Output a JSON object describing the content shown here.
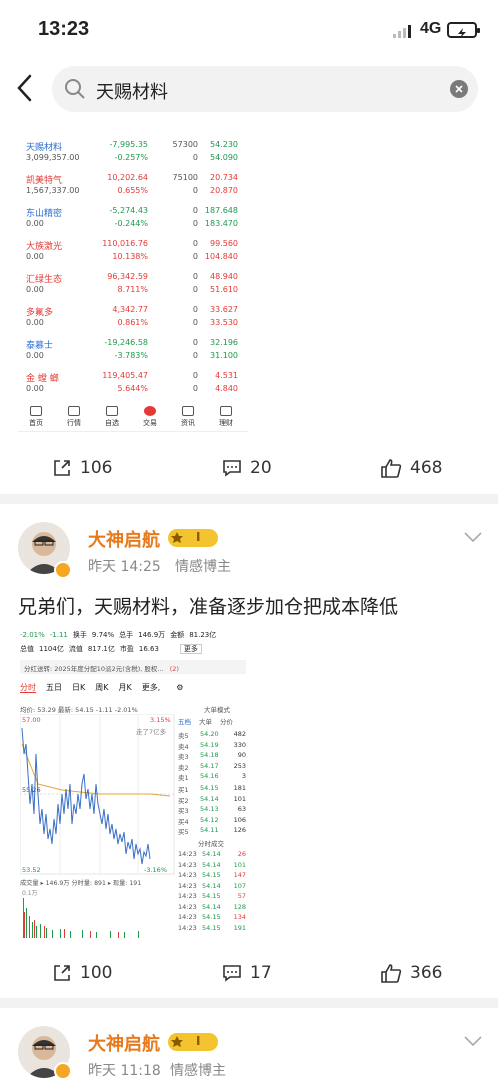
{
  "status_bar": {
    "time": "13:23",
    "network": "4G"
  },
  "search": {
    "query": "天赐材料"
  },
  "post1": {
    "screenshot": {
      "stocks": [
        {
          "name": "天赐材料",
          "sub": "3,099,357.00",
          "v1": "-7,995.35",
          "v1b": "-0.257%",
          "v2": "57300",
          "v2b": "0",
          "v3": "54.230",
          "v3b": "54.090",
          "color": "blue"
        },
        {
          "name": "凯美特气",
          "sub": "1,567,337.00",
          "v1": "10,202.64",
          "v1b": "0.655%",
          "v2": "75100",
          "v2b": "0",
          "v3": "20.734",
          "v3b": "20.870",
          "color": "red"
        },
        {
          "name": "东山精密",
          "sub": "0.00",
          "v1": "-5,274.43",
          "v1b": "-0.244%",
          "v2": "0",
          "v2b": "0",
          "v3": "187.648",
          "v3b": "183.470",
          "color": "blue"
        },
        {
          "name": "大族激光",
          "sub": "0.00",
          "v1": "110,016.76",
          "v1b": "10.138%",
          "v2": "0",
          "v2b": "0",
          "v3": "99.560",
          "v3b": "104.840",
          "color": "red"
        },
        {
          "name": "汇绿生态",
          "sub": "0.00",
          "v1": "96,342.59",
          "v1b": "8.711%",
          "v2": "0",
          "v2b": "0",
          "v3": "48.940",
          "v3b": "51.610",
          "color": "red"
        },
        {
          "name": "多氟多",
          "sub": "0.00",
          "v1": "4,342.77",
          "v1b": "0.861%",
          "v2": "0",
          "v2b": "0",
          "v3": "33.627",
          "v3b": "33.530",
          "color": "red"
        },
        {
          "name": "泰慕士",
          "sub": "0.00",
          "v1": "-19,246.58",
          "v1b": "-3.783%",
          "v2": "0",
          "v2b": "0",
          "v3": "32.196",
          "v3b": "31.100",
          "color": "blue"
        },
        {
          "name": "金 螳 螂",
          "sub": "0.00",
          "v1": "119,405.47",
          "v1b": "5.644%",
          "v2": "0",
          "v2b": "0",
          "v3": "4.531",
          "v3b": "4.840",
          "color": "red"
        }
      ],
      "nav": [
        "首页",
        "行情",
        "自选",
        "交易",
        "资讯",
        "理财"
      ]
    },
    "actions": {
      "share": "106",
      "comment": "20",
      "like": "468"
    }
  },
  "post2": {
    "author": "大神启航",
    "level": "I",
    "time": "昨天 14:25",
    "tag": "情感博主",
    "text": "兄弟们，天赐材料，准备逐步加仓把成本降低",
    "screenshot": {
      "header1": [
        "-2.01%",
        "-1.11",
        "换手",
        "9.74%",
        "总手",
        "146.9万",
        "金额",
        "81.23亿"
      ],
      "header2": [
        "总值",
        "1104亿",
        "流值",
        "817.1亿",
        "市盈",
        "16.63",
        "更多"
      ],
      "dividend": "分红送转: 2025年度分配10派2元(含税), 股权...",
      "dividend_count": "(2)",
      "tabs": [
        "分时",
        "五日",
        "日K",
        "周K",
        "月K",
        "更多,"
      ],
      "price_line": "均价: 53.29  最新: 54.15 -1.11 -2.01%",
      "top_price": "57.00",
      "top_pct": "3.15%",
      "mid_price": "55.26",
      "bottom_price": "53.52",
      "bottom_pct": "-3.16%",
      "overlay": "走了7亿多",
      "orderbook_title": "五档",
      "orderbook_cols": [
        "大单",
        "分价"
      ],
      "mode": "大单模式",
      "asks": [
        [
          "卖5",
          "54.20",
          "482"
        ],
        [
          "卖4",
          "54.19",
          "330"
        ],
        [
          "卖3",
          "54.18",
          "90"
        ],
        [
          "卖2",
          "54.17",
          "253"
        ],
        [
          "卖1",
          "54.16",
          "3"
        ]
      ],
      "bids": [
        [
          "买1",
          "54.15",
          "181"
        ],
        [
          "买2",
          "54.14",
          "101"
        ],
        [
          "买3",
          "54.13",
          "63"
        ],
        [
          "买4",
          "54.12",
          "106"
        ],
        [
          "买5",
          "54.11",
          "126"
        ]
      ],
      "ticks_title": "分时成交",
      "ticks": [
        [
          "14:23",
          "54.14",
          "26"
        ],
        [
          "14:23",
          "54.14",
          "101"
        ],
        [
          "14:23",
          "54.15",
          "147"
        ],
        [
          "14:23",
          "54.14",
          "107"
        ],
        [
          "14:23",
          "54.15",
          "57"
        ],
        [
          "14:23",
          "54.14",
          "128"
        ],
        [
          "14:23",
          "54.15",
          "134"
        ],
        [
          "14:23",
          "54.15",
          "191"
        ]
      ],
      "volume_line": "成交量 ▸ 146.9万  分时量: 891 ▸  现量: 191",
      "volume_top": "0.1万"
    },
    "actions": {
      "share": "100",
      "comment": "17",
      "like": "366"
    }
  },
  "post3": {
    "author": "大神启航",
    "level": "I",
    "time": "昨天 11:18",
    "tag": "情感博主"
  },
  "colors": {
    "accent": "#e87a1e",
    "red": "#e53935",
    "green": "#1e9a4a",
    "blue": "#2a6bd0"
  }
}
